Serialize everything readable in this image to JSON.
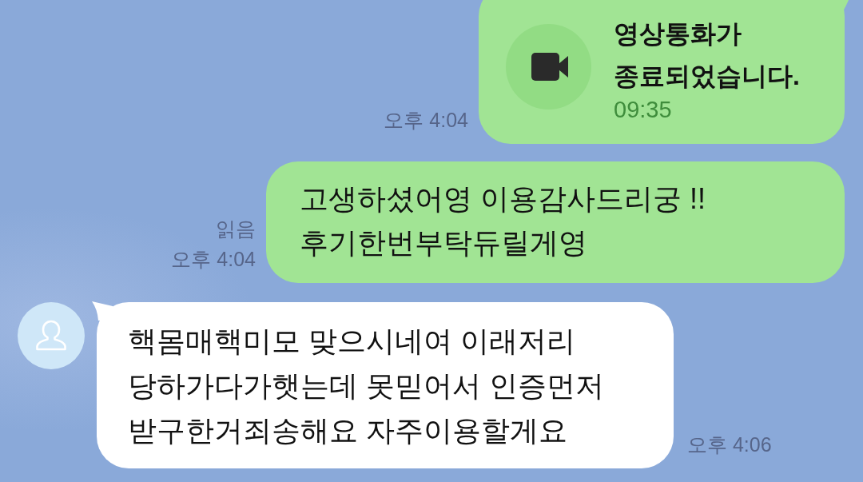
{
  "messages": [
    {
      "kind": "call",
      "outgoing": true,
      "title": "영상통화가\n종료되었습니다.",
      "duration": "09:35",
      "time": "오후 4:04"
    },
    {
      "kind": "text",
      "outgoing": true,
      "text": "고생하셨어영 이용감사드리궁 !!\n후기한번부탁듀릴게영",
      "read_label": "읽음",
      "time": "오후 4:04"
    },
    {
      "kind": "text",
      "outgoing": false,
      "text": "핵몸매핵미모 맞으시네여 이래저리\n당하가다가햇는데 못믿어서 인증먼저\n받구한거죄송해요 자주이용할게요",
      "time": "오후 4:06"
    }
  ]
}
